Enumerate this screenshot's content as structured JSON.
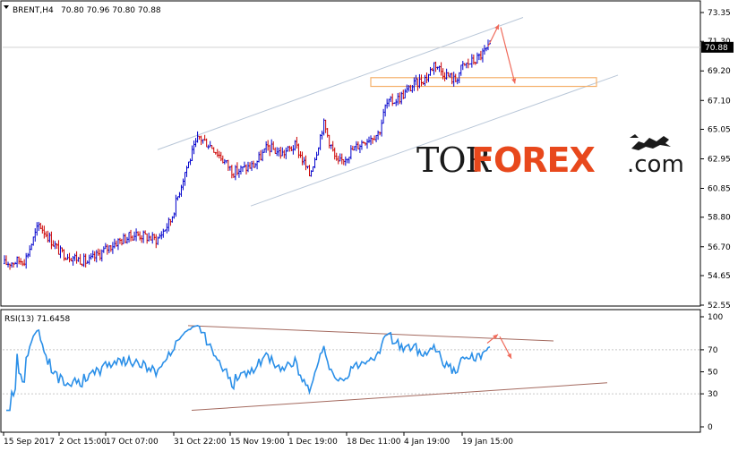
{
  "header": {
    "symbol": "BRENT,H4",
    "ohlc": "70.80 70.96 70.80 70.88"
  },
  "rsi_header": "RSI(13) 71.6458",
  "logo": {
    "part1": "TOR",
    "part2": "FOREX",
    "part3": ".com"
  },
  "colors": {
    "bull": "#0000cc",
    "bear": "#cc0000",
    "rsi": "#2a8fe8",
    "channel": "#b9c7d8",
    "rsi_lines": "#a46a5f",
    "arrow": "#f06a5a",
    "zone": "#f5b06a"
  },
  "chart_data": [
    {
      "type": "candlestick",
      "symbol": "BRENT",
      "timeframe": "H4",
      "current_price": "70.88",
      "y_ticks": [
        "73.35",
        "71.30",
        "69.20",
        "67.10",
        "65.05",
        "62.95",
        "60.85",
        "58.80",
        "56.70",
        "54.65",
        "52.55"
      ],
      "x_ticks": [
        "15 Sep 2017",
        "2 Oct 15:00",
        "17 Oct 07:00",
        "31 Oct 22:00",
        "15 Nov 19:00",
        "1 Dec 19:00",
        "18 Dec 11:00",
        "4 Jan 19:00",
        "19 Jan 15:00"
      ],
      "ylim": [
        52.55,
        73.35
      ],
      "price_path": [
        [
          0,
          55.5
        ],
        [
          0.03,
          55.8
        ],
        [
          0.05,
          58.3
        ],
        [
          0.08,
          56.3
        ],
        [
          0.12,
          55.6
        ],
        [
          0.16,
          57.0
        ],
        [
          0.19,
          57.6
        ],
        [
          0.22,
          57.2
        ],
        [
          0.24,
          58.6
        ],
        [
          0.26,
          62.0
        ],
        [
          0.28,
          64.5
        ],
        [
          0.3,
          63.8
        ],
        [
          0.33,
          62.0
        ],
        [
          0.36,
          62.5
        ],
        [
          0.38,
          63.8
        ],
        [
          0.4,
          63.3
        ],
        [
          0.42,
          63.9
        ],
        [
          0.44,
          61.8
        ],
        [
          0.45,
          63.5
        ],
        [
          0.46,
          65.5
        ],
        [
          0.48,
          62.5
        ],
        [
          0.5,
          63.5
        ],
        [
          0.52,
          64.3
        ],
        [
          0.54,
          64.8
        ],
        [
          0.55,
          66.8
        ],
        [
          0.57,
          67.3
        ],
        [
          0.59,
          68.2
        ],
        [
          0.61,
          68.8
        ],
        [
          0.62,
          69.8
        ],
        [
          0.63,
          69.2
        ],
        [
          0.65,
          68.5
        ],
        [
          0.66,
          69.5
        ],
        [
          0.68,
          70.0
        ],
        [
          0.7,
          70.9
        ]
      ]
    },
    {
      "type": "line",
      "name": "RSI(13)",
      "value": "71.6458",
      "y_ticks": [
        "100",
        "70",
        "50",
        "30",
        "0"
      ],
      "ylim": [
        0,
        100
      ]
    }
  ]
}
